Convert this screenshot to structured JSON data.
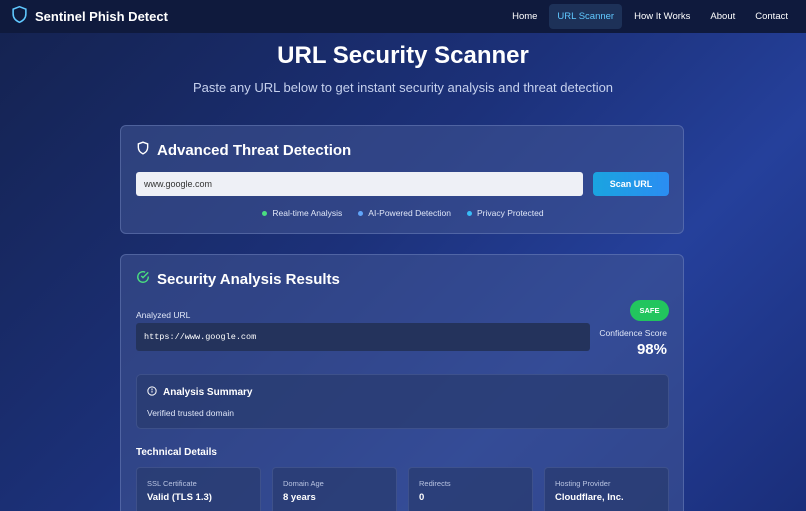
{
  "nav": {
    "brand": "Sentinel Phish Detect",
    "links": [
      "Home",
      "URL Scanner",
      "How It Works",
      "About",
      "Contact"
    ]
  },
  "hero": {
    "title": "URL Security Scanner",
    "subtitle": "Paste any URL below to get instant security analysis and threat detection"
  },
  "scanner": {
    "title": "Advanced Threat Detection",
    "input_value": "www.google.com",
    "button": "Scan URL",
    "features": [
      {
        "label": "Real-time Analysis",
        "color": "#4ade80"
      },
      {
        "label": "AI-Powered Detection",
        "color": "#60a5fa"
      },
      {
        "label": "Privacy Protected",
        "color": "#38bdf8"
      }
    ]
  },
  "results": {
    "title": "Security Analysis Results",
    "analyzed_label": "Analyzed URL",
    "analyzed_url": "https://www.google.com",
    "badge": "SAFE",
    "confidence_label": "Confidence Score",
    "confidence_value": "98%",
    "summary_title": "Analysis Summary",
    "summary_text": "Verified trusted domain",
    "tech_title": "Technical Details",
    "details": [
      {
        "label": "SSL Certificate",
        "value": "Valid (TLS 1.3)"
      },
      {
        "label": "Domain Age",
        "value": "8 years"
      },
      {
        "label": "Redirects",
        "value": "0"
      },
      {
        "label": "Hosting Provider",
        "value": "Cloudflare, Inc."
      }
    ]
  },
  "colors": {
    "accent": "#60c8ff",
    "safe": "#22c55e",
    "button": "#2b8df2"
  }
}
